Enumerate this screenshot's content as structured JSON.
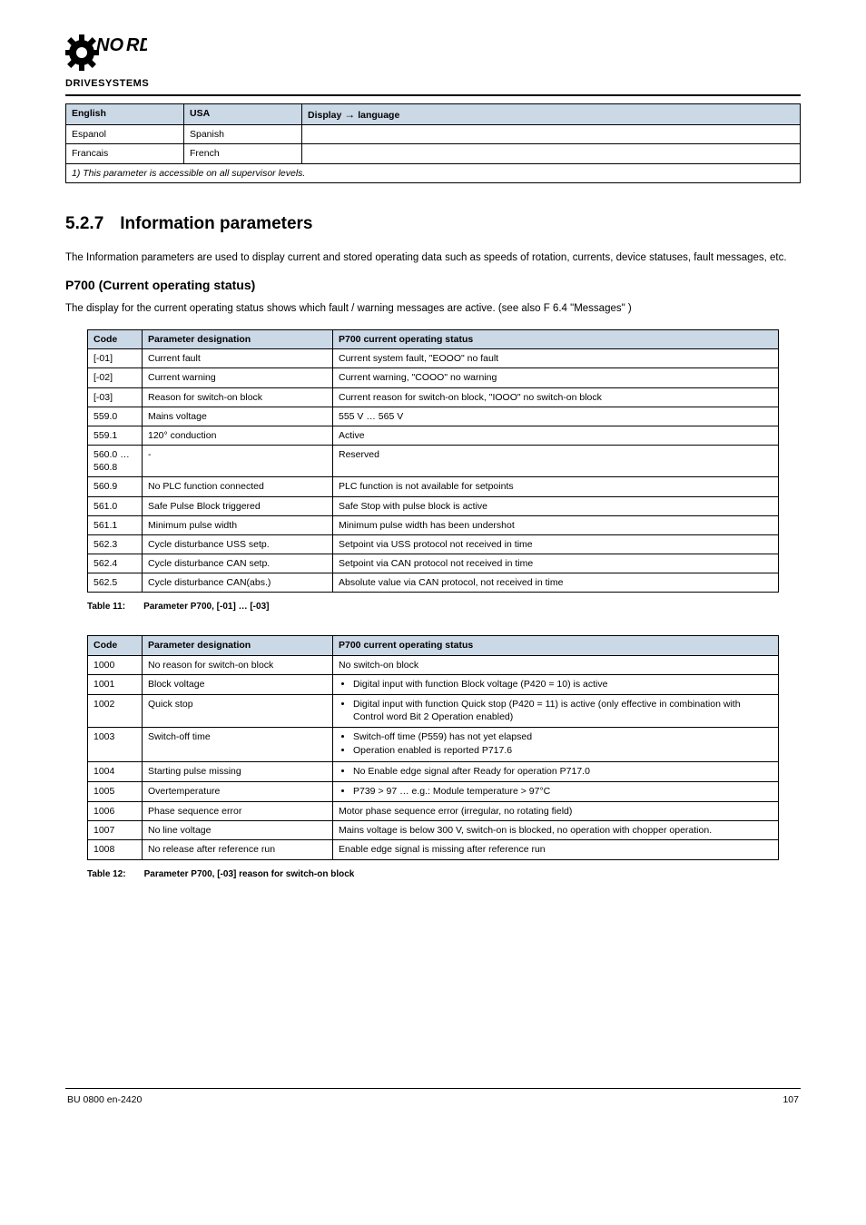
{
  "logo": {
    "brand": "NORD",
    "sub": "DRIVESYSTEMS"
  },
  "tableA": {
    "headers": {
      "c1": "English",
      "c2": "USA",
      "c3": "Display ",
      "arrow": "→",
      "c3b": " language"
    },
    "rows": [
      {
        "c1": "Espanol",
        "c2": "Spanish"
      },
      {
        "c1": "Francais",
        "c2": "French"
      }
    ],
    "foot": "1) This parameter is accessible on all supervisor levels."
  },
  "section": {
    "num": "5.2.7",
    "title": "Information parameters",
    "intro": "The Information parameters are used to display current and stored operating data such as speeds of rotation, currents, device statuses, fault messages, etc."
  },
  "p700block": {
    "title": "P700 (Current operating status)",
    "text": "The display for the current operating status shows which fault / warning messages are active. (see also F ",
    "section_ref": "6.4 \"Messages\"",
    "text2": ")"
  },
  "table1": {
    "headers": {
      "c1": "Code",
      "c2": "Parameter designation",
      "c3": "P700 current operating status"
    },
    "rows": [
      {
        "c1": "[-01]",
        "c2": "Current fault",
        "c3": "Current system fault, \"EOOO\" no fault"
      },
      {
        "c1": "[-02]",
        "c2": "Current warning",
        "c3": "Current warning, \"COOO\" no warning"
      },
      {
        "c1": "[-03]",
        "c2": "Reason for switch-on block",
        "c3": "Current reason for switch-on block, \"IOOO\" no switch-on block"
      },
      {
        "c1": "559.0",
        "c2": "Mains voltage",
        "c3": "555 V … 565 V"
      },
      {
        "c1": "559.1",
        "c2": "120° conduction",
        "c3": "Active"
      },
      {
        "c1": "560.0 … 560.8",
        "c2": "-",
        "c3": "Reserved"
      },
      {
        "c1": "560.9",
        "c2": "No PLC function connected",
        "c3": "PLC function is not available for setpoints"
      },
      {
        "c1": "561.0",
        "c2": "Safe Pulse Block triggered",
        "c3": "Safe Stop with pulse block is active"
      },
      {
        "c1": "561.1",
        "c2": "Minimum pulse width",
        "c3": "Minimum pulse width has been undershot"
      },
      {
        "c1": "562.3",
        "c2": "Cycle disturbance USS setp.",
        "c3": "Setpoint via USS protocol not received in time"
      },
      {
        "c1": "562.4",
        "c2": "Cycle disturbance CAN setp.",
        "c3": "Setpoint via CAN protocol not received in time"
      },
      {
        "c1": "562.5",
        "c2": "Cycle disturbance CAN(abs.)",
        "c3": "Absolute value via CAN protocol, not received in time"
      }
    ],
    "caption_a": "Table 11:",
    "caption_b": "Parameter P700, [-01] … [-03]"
  },
  "table2": {
    "headers": {
      "c1": "Code",
      "c2": "Parameter designation",
      "c3": "P700 current operating status"
    },
    "rows": [
      {
        "c1": "1000",
        "c2": "No reason for switch-on block",
        "c3": [
          "No switch-on block"
        ]
      },
      {
        "c1": "1001",
        "c2": "Block voltage",
        "c3": [
          "Digital input with function Block voltage (P420 = 10) is active"
        ]
      },
      {
        "c1": "1002",
        "c2": "Quick stop",
        "c3": [
          "Digital input with function Quick stop (P420 = 11) is active (only effective in combination with Control word Bit 2 Operation enabled)"
        ]
      },
      {
        "c1": "1003",
        "c2": "Switch-off time",
        "c3": [
          "Switch-off time (P559) has not yet elapsed",
          "Operation enabled is reported P717.6"
        ]
      },
      {
        "c1": "1004",
        "c2": "Starting pulse missing",
        "c3": [
          "No Enable edge signal after Ready for operation P717.0"
        ]
      },
      {
        "c1": "1005",
        "c2": "Overtemperature",
        "c3": [
          "P739 > 97 … e.g.: Module temperature > 97°C"
        ]
      },
      {
        "c1": "1006",
        "c2": "Phase sequence error",
        "c3": [
          "Motor phase sequence error (irregular, no rotating field)"
        ]
      },
      {
        "c1": "1007",
        "c2": "No line voltage",
        "c3": [
          "Mains voltage is below 300 V, switch-on is blocked, no operation with chopper operation."
        ]
      },
      {
        "c1": "1008",
        "c2": "No release after reference run",
        "c3": [
          "Enable edge signal is missing after reference run"
        ]
      }
    ],
    "caption_a": "Table 12:",
    "caption_b": "Parameter P700, [-03] reason for switch-on block"
  },
  "footer": {
    "left": "BU 0800 en-2420",
    "right": "107"
  }
}
